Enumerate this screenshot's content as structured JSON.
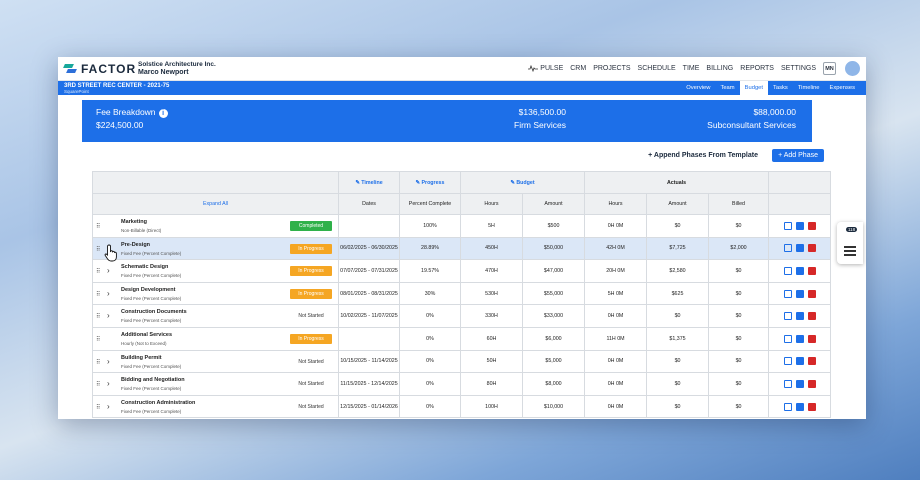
{
  "app": {
    "logo": "FACTOR",
    "company": "Solstice Architecture Inc.",
    "user": "Marco Newport"
  },
  "nav": {
    "pulse": "PULSE",
    "items": [
      "CRM",
      "PROJECTS",
      "SCHEDULE",
      "TIME",
      "BILLING",
      "REPORTS",
      "SETTINGS"
    ],
    "avatar": "MN"
  },
  "project": {
    "title": "3RD STREET REC CENTER - 2021-75",
    "subtitle": "SquarePoint",
    "tabs": [
      "Overview",
      "Team",
      "Budget",
      "Tasks",
      "Timeline",
      "Expenses"
    ],
    "active_tab": "Budget"
  },
  "fee": {
    "label": "Fee Breakdown",
    "total": "$224,500.00",
    "firm_amount": "$136,500.00",
    "firm_label": "Firm Services",
    "consult_amount": "$88,000.00",
    "consult_label": "Subconsultant Services"
  },
  "actions": {
    "append": "+ Append Phases From Template",
    "add_phase": "+ Add Phase"
  },
  "table": {
    "groups": {
      "timeline": "Timeline",
      "progress": "Progress",
      "budget": "Budget",
      "actuals": "Actuals"
    },
    "expand_all": "Expand All",
    "columns": [
      "Dates",
      "Percent Complete",
      "Hours",
      "Amount",
      "Hours",
      "Amount",
      "Billed"
    ],
    "rows": [
      {
        "name": "Marketing",
        "type": "Non-Billable (Direct)",
        "status": "Completed",
        "status_kind": "completed",
        "expandable": false,
        "dates": "",
        "pct": "100%",
        "bhours": "5H",
        "bamount": "$500",
        "ahours": "0H 0M",
        "aamount": "$0",
        "billed": "$0"
      },
      {
        "name": "Pre-Design",
        "type": "Fixed Fee (Percent Complete)",
        "status": "In Progress",
        "status_kind": "inprog",
        "expandable": false,
        "selected": true,
        "dates": "06/02/2025 - 06/30/2025",
        "pct": "28.89%",
        "bhours": "450H",
        "bamount": "$50,000",
        "ahours": "42H 0M",
        "aamount": "$7,725",
        "billed": "$2,000"
      },
      {
        "name": "Schematic Design",
        "type": "Fixed Fee (Percent Complete)",
        "status": "In Progress",
        "status_kind": "inprog",
        "expandable": true,
        "dates": "07/07/2025 - 07/31/2025",
        "pct": "19.57%",
        "bhours": "470H",
        "bamount": "$47,000",
        "ahours": "20H 0M",
        "aamount": "$2,580",
        "billed": "$0"
      },
      {
        "name": "Design Development",
        "type": "Fixed Fee (Percent Complete)",
        "status": "In Progress",
        "status_kind": "inprog",
        "expandable": true,
        "dates": "08/01/2025 - 08/31/2025",
        "pct": "30%",
        "bhours": "530H",
        "bamount": "$55,000",
        "ahours": "5H 0M",
        "aamount": "$625",
        "billed": "$0"
      },
      {
        "name": "Construction Documents",
        "type": "Fixed Fee (Percent Complete)",
        "status": "Not Started",
        "status_kind": "notstarted",
        "expandable": true,
        "dates": "10/02/2025 - 11/07/2025",
        "pct": "0%",
        "bhours": "330H",
        "bamount": "$33,000",
        "ahours": "0H 0M",
        "aamount": "$0",
        "billed": "$0"
      },
      {
        "name": "Additional Services",
        "type": "Hourly (Not to Exceed)",
        "status": "In Progress",
        "status_kind": "inprog",
        "expandable": false,
        "dates": "",
        "pct": "0%",
        "bhours": "60H",
        "bamount": "$6,000",
        "ahours": "11H 0M",
        "aamount": "$1,375",
        "billed": "$0"
      },
      {
        "name": "Building Permit",
        "type": "Fixed Fee (Percent Complete)",
        "status": "Not Started",
        "status_kind": "notstarted",
        "expandable": true,
        "dates": "10/15/2025 - 11/14/2025",
        "pct": "0%",
        "bhours": "50H",
        "bamount": "$5,000",
        "ahours": "0H 0M",
        "aamount": "$0",
        "billed": "$0"
      },
      {
        "name": "Bidding and Negotiation",
        "type": "Fixed Fee (Percent Complete)",
        "status": "Not Started",
        "status_kind": "notstarted",
        "expandable": true,
        "dates": "11/15/2025 - 12/14/2025",
        "pct": "0%",
        "bhours": "80H",
        "bamount": "$8,000",
        "ahours": "0H 0M",
        "aamount": "$0",
        "billed": "$0"
      },
      {
        "name": "Construction Administration",
        "type": "Fixed Fee (Percent Complete)",
        "status": "Not Started",
        "status_kind": "notstarted",
        "expandable": true,
        "dates": "12/15/2025 - 01/14/2026",
        "pct": "0%",
        "bhours": "100H",
        "bamount": "$10,000",
        "ahours": "0H 0M",
        "aamount": "$0",
        "billed": "$0"
      }
    ]
  },
  "side_widget": {
    "badge": "118"
  }
}
